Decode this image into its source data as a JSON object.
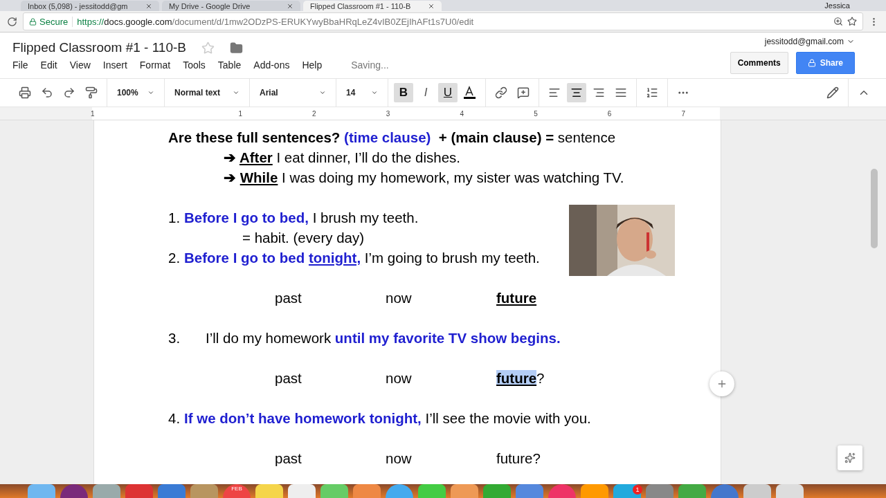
{
  "browser": {
    "tabs": [
      {
        "title": "Inbox (5,098) - jessitodd@gm",
        "selected": false
      },
      {
        "title": "My Drive - Google Drive",
        "selected": false
      },
      {
        "title": "Flipped Classroom #1 - 110-B",
        "selected": true
      }
    ],
    "user": "Jessica",
    "secure_label": "Secure",
    "url_scheme": "https://",
    "url_host": "docs.google.com",
    "url_path": "/document/d/1mw2ODzPS-ERUKYwyBbaHRqLeZ4vIB0ZEjIhAFt1s7U0/edit"
  },
  "docs": {
    "title": "Flipped Classroom #1 - 110-B",
    "account": "jessitodd@gmail.com",
    "menu": [
      "File",
      "Edit",
      "View",
      "Insert",
      "Format",
      "Tools",
      "Table",
      "Add-ons",
      "Help"
    ],
    "status": "Saving...",
    "comments_button": "Comments",
    "share_button": "Share"
  },
  "toolbar": {
    "zoom": "100%",
    "style": "Normal text",
    "font": "Arial",
    "size": "14",
    "bold_label": "B",
    "italic_label": "I",
    "underline_label": "U",
    "bold": true,
    "italic": false,
    "underline": true,
    "align": [
      {
        "kind": "left",
        "selected": false
      },
      {
        "kind": "center",
        "selected": true
      },
      {
        "kind": "right",
        "selected": false
      },
      {
        "kind": "justify",
        "selected": false
      }
    ]
  },
  "ruler": [
    "1",
    "1",
    "2",
    "3",
    "4",
    "5",
    "6",
    "7"
  ],
  "document": [
    {
      "kind": "heading",
      "runs": [
        {
          "text": "Are these full sentences? ",
          "bold": true
        },
        {
          "text": "(time clause)",
          "bold": true,
          "blue": true
        },
        {
          "text": "  + (main clause) =",
          "bold": true
        },
        {
          "text": " sentence"
        }
      ]
    },
    {
      "kind": "arrow",
      "marker": "➔",
      "runs": [
        {
          "text": "After",
          "bold": true,
          "underline": true
        },
        {
          "text": " I eat dinner, I’ll do the dishes."
        }
      ]
    },
    {
      "kind": "arrow",
      "marker": "➔",
      "runs": [
        {
          "text": "While",
          "bold": true,
          "underline": true
        },
        {
          "text": " I was doing my homework, my sister was watching TV."
        }
      ]
    },
    {
      "kind": "blank"
    },
    {
      "kind": "numbered",
      "number": "1.",
      "runs": [
        {
          "text": "Before I go to bed,",
          "bold": true,
          "blue": true
        },
        {
          "text": " I brush my teeth."
        }
      ]
    },
    {
      "kind": "indent",
      "runs": [
        {
          "text": "= habit. (every day)"
        }
      ]
    },
    {
      "kind": "numbered",
      "number": "2.",
      "runs": [
        {
          "text": "Before I go to bed ",
          "bold": true,
          "blue": true
        },
        {
          "text": "tonight,",
          "bold": true,
          "blue": true,
          "underline": true
        },
        {
          "text": " I’m going to brush my teeth."
        }
      ]
    },
    {
      "kind": "blank"
    },
    {
      "kind": "timeline",
      "items": [
        [
          {
            "text": "past"
          }
        ],
        [
          {
            "text": "now"
          }
        ],
        [
          {
            "text": "future",
            "bold": true,
            "underline": true
          }
        ]
      ]
    },
    {
      "kind": "blank"
    },
    {
      "kind": "tabbed",
      "number": "3.",
      "runs": [
        {
          "text": "I’ll do my homework "
        },
        {
          "text": "until my favorite TV show begins.",
          "bold": true,
          "blue": true
        }
      ]
    },
    {
      "kind": "blank"
    },
    {
      "kind": "timeline",
      "items": [
        [
          {
            "text": "past"
          }
        ],
        [
          {
            "text": "now"
          }
        ],
        [
          {
            "text": "future",
            "bold": true,
            "underline": true,
            "selected": true
          },
          {
            "text": "?"
          }
        ]
      ]
    },
    {
      "kind": "blank"
    },
    {
      "kind": "numbered",
      "number": "4.",
      "runs": [
        {
          "text": "If we don’t have homework tonight,",
          "bold": true,
          "blue": true
        },
        {
          "text": " I’ll see the movie with you."
        }
      ]
    },
    {
      "kind": "blank"
    },
    {
      "kind": "timeline",
      "items": [
        [
          {
            "text": "past"
          }
        ],
        [
          {
            "text": "now"
          }
        ],
        [
          {
            "text": "future?"
          }
        ]
      ]
    }
  ],
  "image": {
    "kind": "picture"
  },
  "dock": {
    "calendar_month": "FEB",
    "badge": "1"
  }
}
